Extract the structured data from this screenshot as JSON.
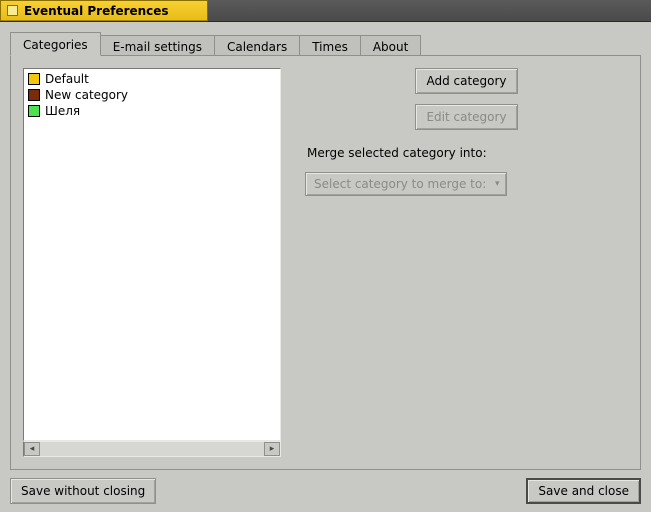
{
  "window": {
    "title": "Eventual Preferences"
  },
  "tabs": [
    {
      "label": "Categories",
      "active": true
    },
    {
      "label": "E-mail settings"
    },
    {
      "label": "Calendars"
    },
    {
      "label": "Times"
    },
    {
      "label": "About"
    }
  ],
  "categories": [
    {
      "name": "Default",
      "color": "#f3c612"
    },
    {
      "name": "New category",
      "color": "#7a2b0a"
    },
    {
      "name": "Шеля",
      "color": "#4fe04f"
    }
  ],
  "buttons": {
    "add_category": "Add category",
    "edit_category": "Edit category",
    "save_without_closing": "Save without closing",
    "save_and_close": "Save and close"
  },
  "labels": {
    "merge_into": "Merge selected category into:"
  },
  "merge_select": {
    "placeholder": "Select category to merge to:",
    "enabled": false
  }
}
